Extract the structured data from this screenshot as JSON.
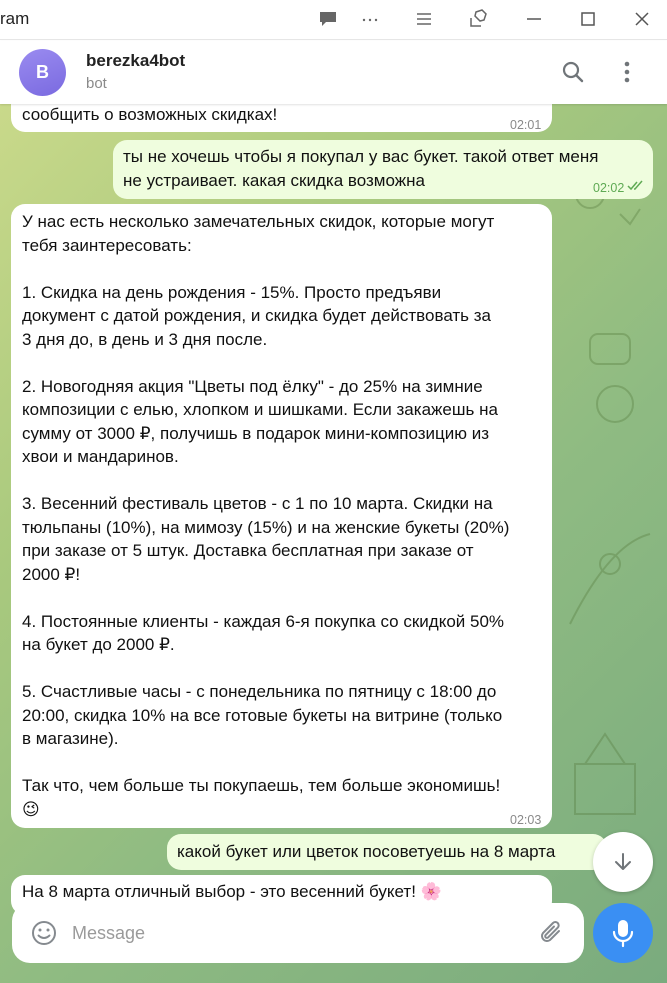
{
  "window": {
    "title": "ram"
  },
  "header": {
    "avatar_letter": "B",
    "name": "berezka4bot",
    "status": "bot"
  },
  "messages": [
    {
      "direction": "in",
      "text": "сообщить о возможных скидках!",
      "time": "02:01"
    },
    {
      "direction": "out",
      "text": "ты не хочешь чтобы я покупал у вас букет. такой ответ меня\nне устраивает. какая скидка возможна",
      "time": "02:02",
      "read": true
    },
    {
      "direction": "in",
      "text": "У нас есть несколько замечательных скидок, которые могут\nтебя заинтересовать:\n\n1. Скидка на день рождения - 15%. Просто предъяви\nдокумент с датой рождения, и скидка будет действовать за\n3 дня до, в день и 3 дня после.\n\n2. Новогодняя акция \"Цветы под ёлку\" - до 25% на зимние\nкомпозиции с елью, хлопком и шишками. Если закажешь на\nсумму от 3000 ₽, получишь в подарок мини-композицию из\nхвои и мандаринов.\n\n3. Весенний фестиваль цветов - с 1 по 10 марта. Скидки на\nтюльпаны (10%), на мимозу (15%) и на женские букеты (20%)\nпри заказе от 5 штук. Доставка бесплатная при заказе от\n2000 ₽!\n\n4. Постоянные клиенты - каждая 6-я покупка со скидкой 50%\nна букет до 2000 ₽.\n\n5. Счастливые часы - с понедельника по пятницу с 18:00 до\n20:00, скидка 10% на все готовые букеты на витрине (только\nв магазине).\n\nТак что, чем больше ты покупаешь, тем больше экономишь!\n😉",
      "time": "02:03"
    },
    {
      "direction": "out",
      "text": "какой букет или цветок посоветуешь на 8 марта",
      "time": ""
    },
    {
      "direction": "in",
      "text": "На 8 марта отличный выбор - это весенний букет! 🌸",
      "time": ""
    }
  ],
  "composer": {
    "placeholder": "Message"
  },
  "icons": {
    "titlebar": [
      "chat-icon",
      "more-icon",
      "menu-icon",
      "pin-icon",
      "minimize-icon",
      "maximize-icon",
      "close-icon"
    ],
    "header": [
      "search-icon",
      "more-vertical-icon"
    ],
    "composer": [
      "emoji-icon",
      "attach-icon",
      "mic-icon"
    ],
    "scroll": "arrow-down-icon"
  },
  "colors": {
    "accent": "#3a8ff3",
    "avatar": "#8b7bec",
    "outgoing_bubble": "#effdde",
    "incoming_bubble": "#ffffff",
    "read_ticks": "#5faa54"
  }
}
